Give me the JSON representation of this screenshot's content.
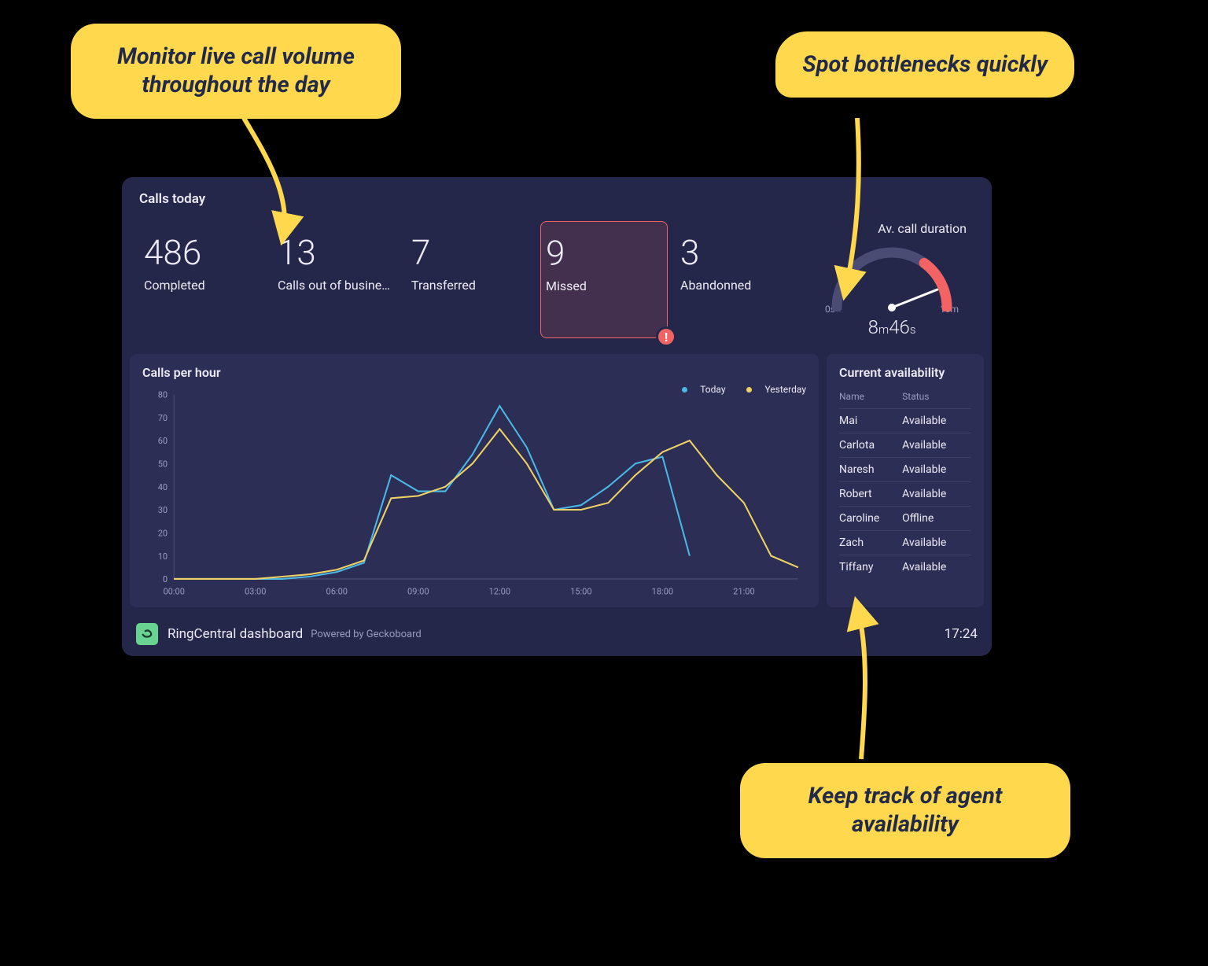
{
  "calls_today": {
    "title": "Calls today",
    "stats": [
      {
        "value": "486",
        "label": "Completed"
      },
      {
        "value": "13",
        "label": "Calls out of busine…"
      },
      {
        "value": "7",
        "label": "Transferred"
      },
      {
        "value": "9",
        "label": "Missed",
        "alert": true
      },
      {
        "value": "3",
        "label": "Abandonned"
      }
    ],
    "gauge": {
      "title": "Av. call duration",
      "min_label": "0s",
      "max_label": "10m",
      "reading_min": "8",
      "reading_min_unit": "m",
      "reading_sec": "46",
      "reading_sec_unit": "s",
      "value_fraction": 0.88,
      "red_zone_start": 0.7
    }
  },
  "chart": {
    "title": "Calls per hour",
    "legend": {
      "today": "Today",
      "yesterday": "Yesterday"
    }
  },
  "chart_data": {
    "type": "line",
    "title": "Calls per hour",
    "xlabel": "",
    "ylabel": "",
    "ylim": [
      0,
      80
    ],
    "x_ticks": [
      "00:00",
      "03:00",
      "06:00",
      "09:00",
      "12:00",
      "15:00",
      "18:00",
      "21:00"
    ],
    "y_ticks": [
      0,
      10,
      20,
      30,
      40,
      50,
      60,
      70,
      80
    ],
    "categories": [
      "00:00",
      "01:00",
      "02:00",
      "03:00",
      "04:00",
      "05:00",
      "06:00",
      "07:00",
      "08:00",
      "09:00",
      "10:00",
      "11:00",
      "12:00",
      "13:00",
      "14:00",
      "15:00",
      "16:00",
      "17:00",
      "18:00",
      "19:00",
      "20:00",
      "21:00",
      "22:00",
      "23:00"
    ],
    "series": [
      {
        "name": "Today",
        "color": "#4ab9e6",
        "values": [
          0,
          0,
          0,
          0,
          0,
          1,
          3,
          7,
          45,
          38,
          38,
          54,
          75,
          57,
          30,
          32,
          40,
          50,
          53,
          10,
          null,
          null,
          null,
          null
        ]
      },
      {
        "name": "Yesterday",
        "color": "#f0d264",
        "values": [
          0,
          0,
          0,
          0,
          1,
          2,
          4,
          8,
          35,
          36,
          40,
          50,
          65,
          50,
          30,
          30,
          33,
          45,
          55,
          60,
          45,
          33,
          10,
          5
        ]
      }
    ]
  },
  "availability": {
    "title": "Current availability",
    "columns": {
      "name": "Name",
      "status": "Status"
    },
    "rows": [
      {
        "name": "Mai",
        "status": "Available"
      },
      {
        "name": "Carlota",
        "status": "Available"
      },
      {
        "name": "Naresh",
        "status": "Available"
      },
      {
        "name": "Robert",
        "status": "Available"
      },
      {
        "name": "Caroline",
        "status": "Offline"
      },
      {
        "name": "Zach",
        "status": "Available"
      },
      {
        "name": "Tiffany",
        "status": "Available"
      }
    ]
  },
  "footer": {
    "title": "RingCentral dashboard",
    "powered": "Powered by Geckoboard",
    "time": "17:24"
  },
  "callouts": {
    "c1": "Monitor live call volume throughout the day",
    "c2": "Spot bottlenecks quickly",
    "c3": "Keep track of agent availability"
  }
}
